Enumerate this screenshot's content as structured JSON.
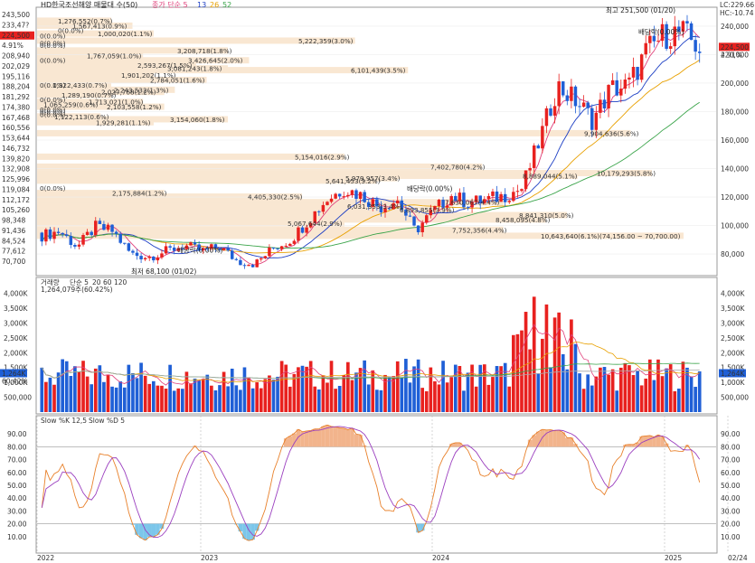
{
  "window": {
    "title": "HD한국조선해양 매물대 수(50)",
    "legend": [
      {
        "label": "종가 단순 5",
        "color": "#e0407b"
      },
      {
        "label": "13",
        "color": "#1d3fc4"
      },
      {
        "label": "26",
        "color": "#e8a000"
      },
      {
        "label": "52",
        "color": "#3aa44a"
      }
    ],
    "lc_label": "LC:229.66",
    "hc_label": "HC:-10.74",
    "colors": {
      "up": "#e8211f",
      "down": "#1f5fd6",
      "ma5": "#e0407b",
      "ma13": "#1d3fc4",
      "ma26": "#e8a000",
      "ma52": "#3aa44a",
      "profile": "#f9e7d2"
    }
  },
  "chart_data": [
    {
      "type": "candlestick",
      "title": "HD한국조선해양 매물대 수(50)",
      "moving_averages": [
        "종가 단순 5",
        "13",
        "26",
        "52"
      ],
      "y_axis_right": {
        "ticks": [
          80000,
          100000,
          120000,
          140000,
          160000,
          180000,
          200000,
          220000,
          240000
        ]
      },
      "y_axis_left_ticks": [
        "243,500",
        "233,47?",
        "224,500",
        "4.91%",
        "208,940",
        "202,029",
        "195,116",
        "188,204",
        "181,292",
        "174,380",
        "167,468",
        "160,556",
        "153,644",
        "146,732",
        "139,820",
        "132,908",
        "125,996",
        "119,084",
        "112,172",
        "105,260",
        "98,348",
        "91,436",
        "84,524",
        "77,612",
        "70,700"
      ],
      "current_price": "224,500",
      "current_change": "4.91%",
      "ylim": [
        68000,
        252000
      ],
      "x_axis_labels": [
        "2022",
        "2023",
        "2024",
        "2025",
        "02/24"
      ],
      "annotations": [
        {
          "text": "최고 251,500 (01/20)",
          "x": "2025-01-20",
          "y": 251500
        },
        {
          "text": "최저 68,100 (01/02)",
          "x": "2023-01-02",
          "y": 68100
        },
        {
          "text": "배당락(0.00%)",
          "x": "2022-12-28",
          "y": 83000
        },
        {
          "text": "배당락(0.00%)",
          "x": "2023-12-27",
          "y": 126000
        },
        {
          "text": "배당락(0.00%)",
          "x": "2024-12-27",
          "y": 236000
        }
      ],
      "monthly_close": [
        {
          "x": "2022-01",
          "o": 95000,
          "c": 93000,
          "h": 99000,
          "l": 88000
        },
        {
          "x": "2022-02",
          "o": 93000,
          "c": 96000,
          "h": 100000,
          "l": 90000
        },
        {
          "x": "2022-03",
          "o": 96000,
          "c": 85000,
          "h": 97000,
          "l": 82000
        },
        {
          "x": "2022-04",
          "o": 85000,
          "c": 99000,
          "h": 104000,
          "l": 84000
        },
        {
          "x": "2022-05",
          "o": 99000,
          "c": 96000,
          "h": 102000,
          "l": 92000
        },
        {
          "x": "2022-06",
          "o": 96000,
          "c": 80000,
          "h": 97000,
          "l": 74000
        },
        {
          "x": "2022-07",
          "o": 80000,
          "c": 78000,
          "h": 84000,
          "l": 72000
        },
        {
          "x": "2022-08",
          "o": 78000,
          "c": 82000,
          "h": 85000,
          "l": 75000
        },
        {
          "x": "2022-09",
          "o": 82000,
          "c": 86000,
          "h": 89000,
          "l": 79000
        },
        {
          "x": "2022-10",
          "o": 86000,
          "c": 82000,
          "h": 88000,
          "l": 78000
        },
        {
          "x": "2022-11",
          "o": 82000,
          "c": 85000,
          "h": 87000,
          "l": 79000
        },
        {
          "x": "2022-12",
          "o": 85000,
          "c": 75000,
          "h": 86000,
          "l": 72000
        },
        {
          "x": "2023-01",
          "o": 75000,
          "c": 73000,
          "h": 77000,
          "l": 68100
        },
        {
          "x": "2023-02",
          "o": 73000,
          "c": 84000,
          "h": 86000,
          "l": 72000
        },
        {
          "x": "2023-03",
          "o": 84000,
          "c": 90000,
          "h": 92000,
          "l": 80000
        },
        {
          "x": "2023-04",
          "o": 90000,
          "c": 104000,
          "h": 107000,
          "l": 88000
        },
        {
          "x": "2023-05",
          "o": 104000,
          "c": 118000,
          "h": 121000,
          "l": 102000
        },
        {
          "x": "2023-06",
          "o": 118000,
          "c": 126000,
          "h": 130000,
          "l": 114000
        },
        {
          "x": "2023-07",
          "o": 126000,
          "c": 121000,
          "h": 129000,
          "l": 116000
        },
        {
          "x": "2023-08",
          "o": 121000,
          "c": 113000,
          "h": 123000,
          "l": 110000
        },
        {
          "x": "2023-09",
          "o": 113000,
          "c": 118000,
          "h": 121000,
          "l": 108000
        },
        {
          "x": "2023-10",
          "o": 118000,
          "c": 96000,
          "h": 119000,
          "l": 94000
        },
        {
          "x": "2023-11",
          "o": 96000,
          "c": 110000,
          "h": 114000,
          "l": 95000
        },
        {
          "x": "2023-12",
          "o": 110000,
          "c": 121000,
          "h": 127000,
          "l": 108000
        },
        {
          "x": "2024-01",
          "o": 121000,
          "c": 116000,
          "h": 124000,
          "l": 112000
        },
        {
          "x": "2024-02",
          "o": 116000,
          "c": 118000,
          "h": 122000,
          "l": 113000
        },
        {
          "x": "2024-03",
          "o": 118000,
          "c": 121000,
          "h": 125000,
          "l": 115000
        },
        {
          "x": "2024-04",
          "o": 121000,
          "c": 126000,
          "h": 129000,
          "l": 119000
        },
        {
          "x": "2024-05",
          "o": 126000,
          "c": 160000,
          "h": 166000,
          "l": 124000
        },
        {
          "x": "2024-06",
          "o": 160000,
          "c": 198000,
          "h": 204000,
          "l": 156000
        },
        {
          "x": "2024-07",
          "o": 198000,
          "c": 188000,
          "h": 201000,
          "l": 180000
        },
        {
          "x": "2024-08",
          "o": 188000,
          "c": 174000,
          "h": 192000,
          "l": 168000
        },
        {
          "x": "2024-09",
          "o": 174000,
          "c": 196000,
          "h": 202000,
          "l": 170000
        },
        {
          "x": "2024-10",
          "o": 196000,
          "c": 198000,
          "h": 205000,
          "l": 190000
        },
        {
          "x": "2024-11",
          "o": 198000,
          "c": 222000,
          "h": 228000,
          "l": 194000
        },
        {
          "x": "2024-12",
          "o": 222000,
          "c": 234000,
          "h": 238000,
          "l": 216000
        },
        {
          "x": "2025-01",
          "o": 234000,
          "c": 236000,
          "h": 251500,
          "l": 226000
        },
        {
          "x": "2025-02",
          "o": 236000,
          "c": 224500,
          "h": 240000,
          "l": 218000
        }
      ],
      "volume_profile": [
        {
          "price": 243500,
          "label": "1,276,552(0.7%)"
        },
        {
          "price": 240000,
          "label": "1,567,413(0.9%)"
        },
        {
          "price": 236800,
          "label": "0(0.0%)"
        },
        {
          "price": 234500,
          "label": "1,000,020(1.1%)"
        },
        {
          "price": 233000,
          "label": "0(0.0%)"
        },
        {
          "price": 229500,
          "label": "5,222,359(3.0%)"
        },
        {
          "price": 227800,
          "label": "0(0.0%)"
        },
        {
          "price": 226300,
          "label": "0(0.0%)"
        },
        {
          "price": 222600,
          "label": "3,208,718(1.8%)"
        },
        {
          "price": 219100,
          "label": "1,767,059(1.0%)"
        },
        {
          "price": 215700,
          "label": "3,426,645(2.0%)"
        },
        {
          "price": 215700,
          "label": "0(0.0%)"
        },
        {
          "price": 212200,
          "label": "2,593,267(1.5%)"
        },
        {
          "price": 210000,
          "label": "3,081,243(1.8%)"
        },
        {
          "price": 208800,
          "label": "6,101,439(3.5%)"
        },
        {
          "price": 205300,
          "label": "1,901,202(1.1%)"
        },
        {
          "price": 201900,
          "label": "2,784,051(1.6%)"
        },
        {
          "price": 198400,
          "label": "1,322,433(0.7%)"
        },
        {
          "price": 198400,
          "label": "0(0.0%)"
        },
        {
          "price": 195000,
          "label": "2,243,532(1.3%)"
        },
        {
          "price": 193500,
          "label": "2,027,768(1.2%)"
        },
        {
          "price": 191500,
          "label": "1,289,190(0.7%)"
        },
        {
          "price": 188100,
          "label": "0(0.0%)"
        },
        {
          "price": 186500,
          "label": "1,713,021(1.0%)"
        },
        {
          "price": 184600,
          "label": "1,065,259(0.6%)"
        },
        {
          "price": 183100,
          "label": "2,103,558(1.2%)"
        },
        {
          "price": 181200,
          "label": "0(0.0%)"
        },
        {
          "price": 179800,
          "label": "0(0.0%)"
        },
        {
          "price": 177700,
          "label": "0(0.0%)"
        },
        {
          "price": 176300,
          "label": "1,122,113(0.6%)"
        },
        {
          "price": 174300,
          "label": "3,154,060(1.8%)"
        },
        {
          "price": 172200,
          "label": "1,929,281(1.1%)"
        },
        {
          "price": 164500,
          "label": "9,904,636(5.6%)"
        },
        {
          "price": 148000,
          "label": "5,154,016(2.9%)"
        },
        {
          "price": 141000,
          "label": "7,402,780(4.2%)"
        },
        {
          "price": 136500,
          "label": "10,179,293(5.8%)"
        },
        {
          "price": 134600,
          "label": "8,889,044(5.1%)"
        },
        {
          "price": 132900,
          "label": "5,979,957(3.4%)"
        },
        {
          "price": 131200,
          "label": "5,641,453(3.2%)"
        },
        {
          "price": 125996,
          "label": "0(0.0%)"
        },
        {
          "price": 122500,
          "label": "2,175,884(1.2%)"
        },
        {
          "price": 120000,
          "label": "4,405,330(2.5%)"
        },
        {
          "price": 116100,
          "label": "7,630,067(4.4%)"
        },
        {
          "price": 113500,
          "label": "6,031,353(3.4%)"
        },
        {
          "price": 110800,
          "label": "6,893,855(3.9%)"
        },
        {
          "price": 107000,
          "label": "8,841,310(5.0%)"
        },
        {
          "price": 103900,
          "label": "8,458,095(4.8%)"
        },
        {
          "price": 101200,
          "label": "5,067,644(2.9%)"
        },
        {
          "price": 96700,
          "label": "7,752,356(4.4%)"
        },
        {
          "price": 92500,
          "label": "10,643,640(6.1%)(74,156.00 ~ 70,700.00)"
        }
      ]
    },
    {
      "type": "bar",
      "title": "거래량",
      "legend": [
        "거래량",
        "단순 5",
        "20",
        "60",
        "120"
      ],
      "last_value_label": "1,264,079주(60.42%)",
      "y_axis_ticks": [
        "500,000",
        "1,000K",
        "1,500K",
        "2,000K",
        "2,500K",
        "3,000K",
        "3,500K",
        "4,000K"
      ],
      "current_value": "1,264K",
      "current_pct": "60.42%",
      "ylim": [
        0,
        4200000
      ]
    },
    {
      "type": "line",
      "title": "Slow %K 12,5  Slow %D 5",
      "series": [
        {
          "name": "Slow %K 12,5"
        },
        {
          "name": "Slow %D 5"
        }
      ],
      "y_axis_ticks": [
        "10.00",
        "20.00",
        "30.00",
        "40.00",
        "50.00",
        "60.00",
        "70.00",
        "80.00",
        "90.00"
      ],
      "ylim": [
        0,
        100
      ],
      "overbought": 80,
      "oversold": 20
    }
  ]
}
